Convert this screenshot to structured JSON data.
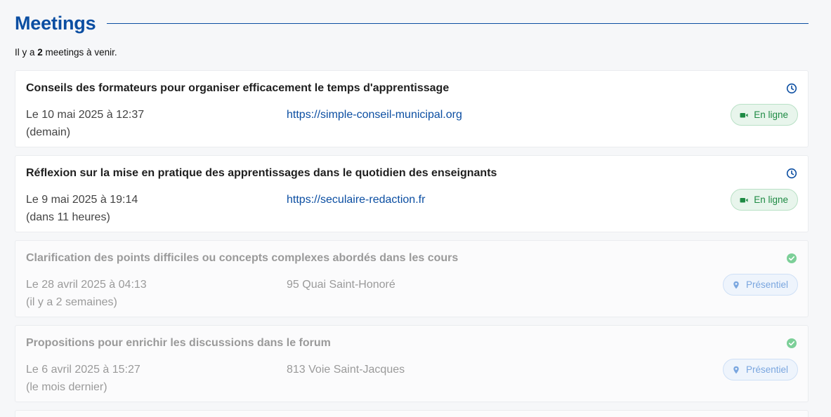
{
  "header": {
    "title": "Meetings"
  },
  "summary": {
    "prefix": "Il y a ",
    "count": "2",
    "suffix": " meetings à venir."
  },
  "meetings": [
    {
      "title": "Conseils des formateurs pour organiser efficacement le temps d'apprentissage",
      "date": "Le 10 mai 2025 à 12:37",
      "relative": "(demain)",
      "location": "https://simple-conseil-municipal.org",
      "badge": "En ligne"
    },
    {
      "title": "Réflexion sur la mise en pratique des apprentissages dans le quotidien des enseignants",
      "date": "Le 9 mai 2025 à 19:14",
      "relative": "(dans 11 heures)",
      "location": "https://seculaire-redaction.fr",
      "badge": "En ligne"
    },
    {
      "title": "Clarification des points difficiles ou concepts complexes abordés dans les cours",
      "date": "Le 28 avril 2025 à 04:13",
      "relative": "(il y a 2 semaines)",
      "location": "95 Quai Saint-Honoré",
      "badge": "Présentiel"
    },
    {
      "title": "Propositions pour enrichir les discussions dans le forum",
      "date": "Le 6 avril 2025 à 15:27",
      "relative": "(le mois dernier)",
      "location": "813 Voie Saint-Jacques",
      "badge": "Présentiel"
    }
  ],
  "icons": {
    "upcoming": "clock-icon",
    "past": "check-circle-icon",
    "online": "video-camera-icon",
    "inperson": "map-pin-icon"
  },
  "colors": {
    "brand": "#0b4ea2",
    "online_badge": "#1e8a44",
    "inperson_badge": "#7aa6df",
    "done_check": "#7ccf98"
  }
}
